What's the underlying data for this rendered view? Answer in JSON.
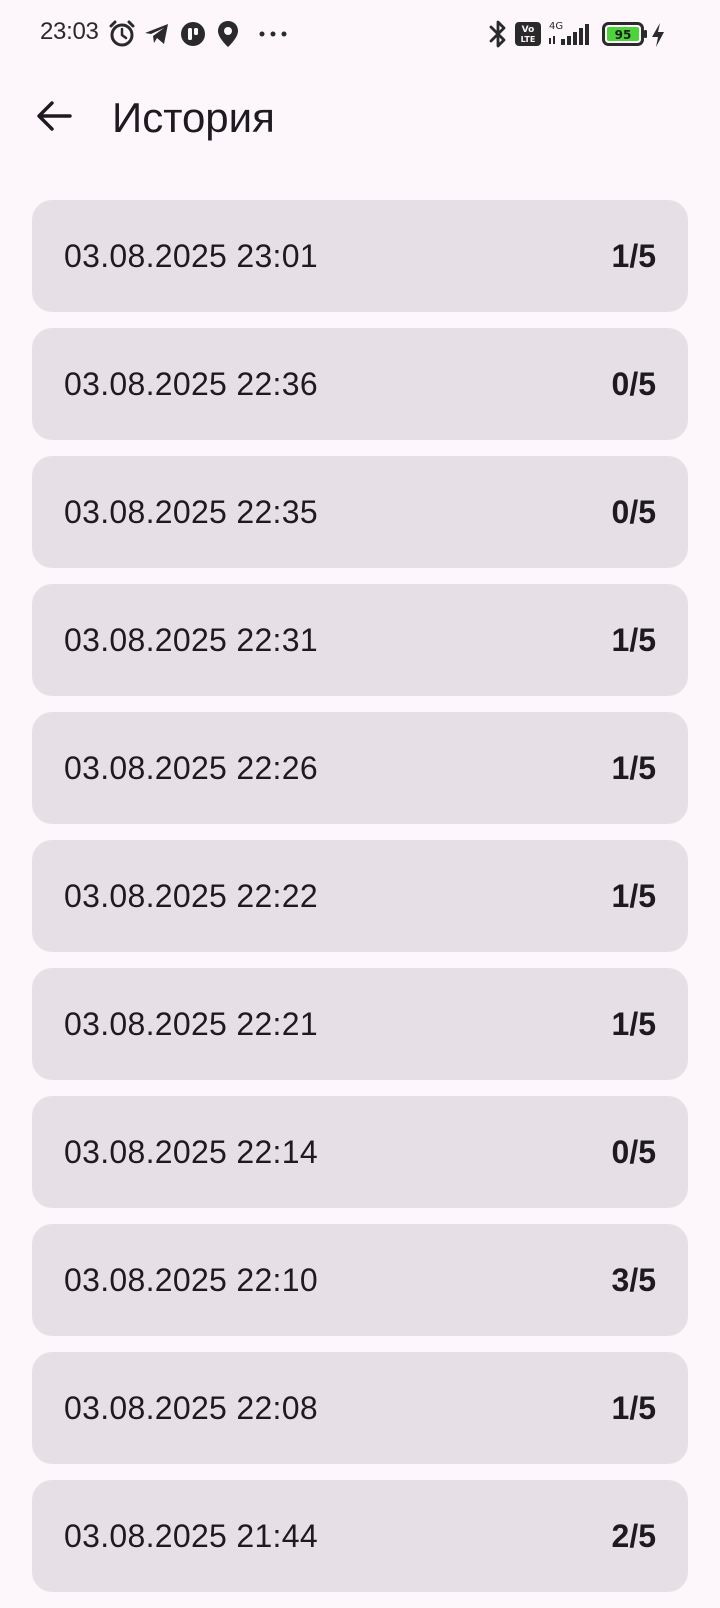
{
  "status_bar": {
    "time": "23:03",
    "battery": "95",
    "network": "4G",
    "volte": "VoLTE",
    "icons": [
      "alarm-icon",
      "telegram-icon",
      "app-icon",
      "location-icon",
      "more-dots-icon",
      "bluetooth-icon",
      "volte-icon",
      "signal-icon",
      "battery-icon",
      "charging-icon"
    ]
  },
  "app_bar": {
    "title": "История",
    "back_icon": "arrow-back-icon"
  },
  "history": [
    {
      "date": "03.08.2025 23:01",
      "score": "1/5"
    },
    {
      "date": "03.08.2025 22:36",
      "score": "0/5"
    },
    {
      "date": "03.08.2025 22:35",
      "score": "0/5"
    },
    {
      "date": "03.08.2025 22:31",
      "score": "1/5"
    },
    {
      "date": "03.08.2025 22:26",
      "score": "1/5"
    },
    {
      "date": "03.08.2025 22:22",
      "score": "1/5"
    },
    {
      "date": "03.08.2025 22:21",
      "score": "1/5"
    },
    {
      "date": "03.08.2025 22:14",
      "score": "0/5"
    },
    {
      "date": "03.08.2025 22:10",
      "score": "3/5"
    },
    {
      "date": "03.08.2025 22:08",
      "score": "1/5"
    },
    {
      "date": "03.08.2025 21:44",
      "score": "2/5"
    }
  ],
  "colors": {
    "background": "#FDF7FC",
    "card": "#E6E0E6",
    "text": "#1D1B20",
    "battery_fill": "#4CD43A"
  }
}
